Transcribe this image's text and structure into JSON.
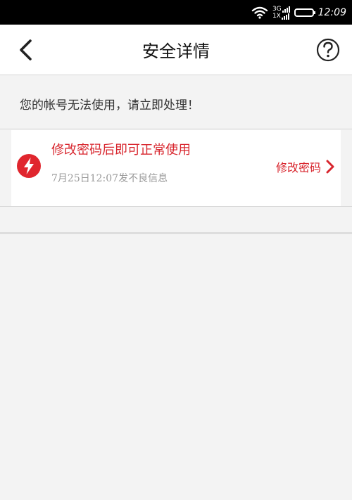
{
  "status_bar": {
    "network_type_top": "3G",
    "network_type_bottom": "1X",
    "time": "12:09"
  },
  "header": {
    "title": "安全详情"
  },
  "notice": {
    "text": "您的帐号无法使用，请立即处理！"
  },
  "alert": {
    "title": "修改密码后即可正常使用",
    "time_info": "7月25日12:07发不良信息",
    "action_label": "修改密码"
  },
  "colors": {
    "accent": "#d8262e",
    "status_bar_bg": "#000000",
    "page_bg": "#f3f3f3"
  },
  "icons": {
    "back": "chevron-left-icon",
    "help": "question-circle-icon",
    "alert": "lightning-bolt-icon",
    "action": "chevron-right-icon",
    "wifi": "wifi-icon",
    "battery": "battery-icon"
  }
}
